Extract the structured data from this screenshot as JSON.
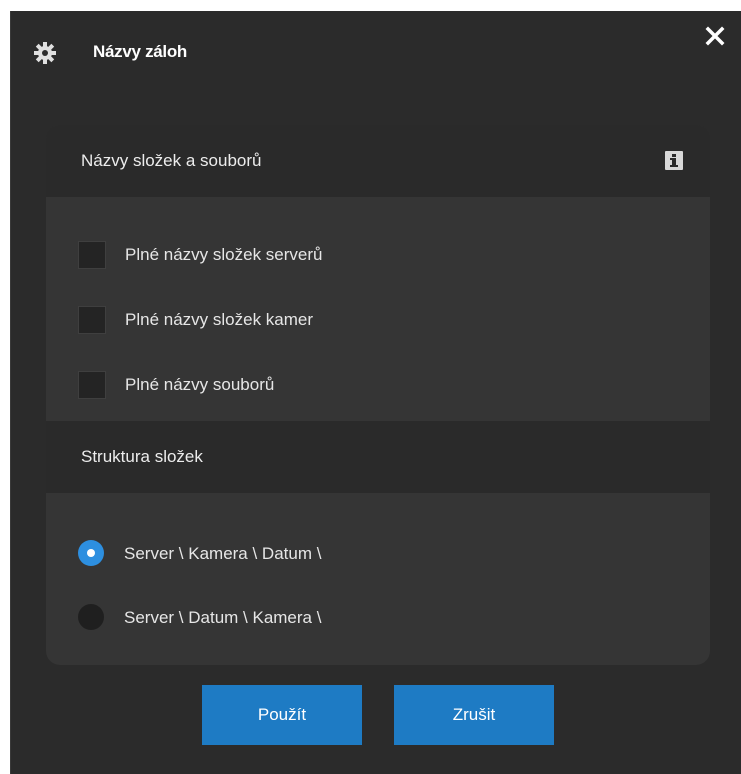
{
  "dialog": {
    "title": "Názvy záloh",
    "title_icon": "gear-icon",
    "close_icon": "close-icon"
  },
  "section_names": {
    "title": "Názvy složek a souborů",
    "info_icon": "info-icon",
    "options": [
      {
        "label": "Plné názvy složek serverů",
        "checked": false
      },
      {
        "label": "Plné názvy složek kamer",
        "checked": false
      },
      {
        "label": "Plné názvy souborů",
        "checked": false
      }
    ]
  },
  "section_structure": {
    "title": "Struktura složek",
    "options": [
      {
        "label": "Server \\ Kamera \\ Datum \\",
        "selected": true
      },
      {
        "label": "Server \\ Datum \\ Kamera \\",
        "selected": false
      }
    ]
  },
  "buttons": {
    "apply_label": "Použít",
    "cancel_label": "Zrušit"
  },
  "colors": {
    "accent": "#1e7bc4",
    "radio_selected": "#2d8fe0",
    "background": "#2b2b2b"
  }
}
